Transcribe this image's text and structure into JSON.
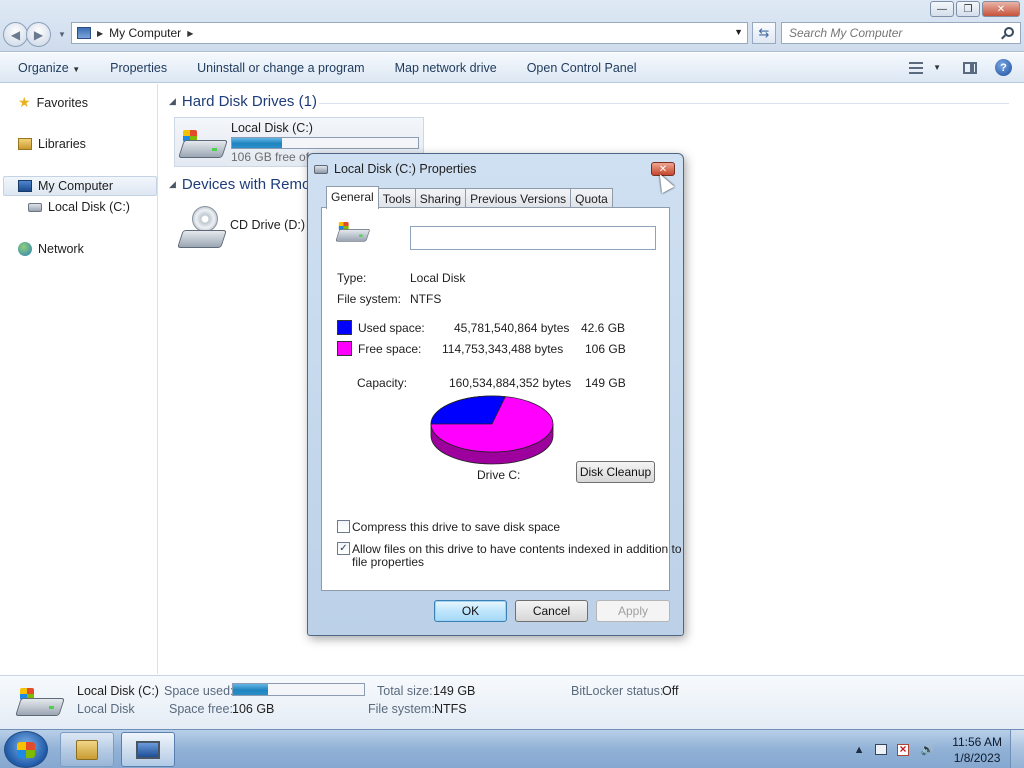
{
  "window": {
    "controls": {
      "minimize": "—",
      "maximize": "❐",
      "close": "✕"
    }
  },
  "address": {
    "crumbs": [
      "My Computer"
    ]
  },
  "search": {
    "placeholder": "Search My Computer"
  },
  "toolbar": {
    "items": [
      "Organize",
      "Properties",
      "Uninstall or change a program",
      "Map network drive",
      "Open Control Panel"
    ],
    "organize_arrow": "▼"
  },
  "nav": {
    "favorites": "Favorites",
    "libraries": "Libraries",
    "computer": "My Computer",
    "local_disk": "Local Disk (C:)",
    "network": "Network"
  },
  "content": {
    "hdd_group": "Hard Disk Drives (1)",
    "hdd": {
      "name": "Local Disk (C:)",
      "free_text": "106 GB free of",
      "used_fraction": 0.27
    },
    "removable_group": "Devices with Remo",
    "cd": {
      "name": "CD Drive (D:)"
    }
  },
  "details": {
    "name": "Local Disk (C:)",
    "type": "Local Disk",
    "space_used_label": "Space used:",
    "space_used_fraction": 0.27,
    "space_free_label": "Space free:",
    "space_free": "106 GB",
    "total_size_label": "Total size:",
    "total_size": "149 GB",
    "filesystem_label": "File system:",
    "filesystem": "NTFS",
    "bitlocker_label": "BitLocker status:",
    "bitlocker": "Off"
  },
  "dialog": {
    "title": "Local Disk (C:) Properties",
    "close": "✕",
    "tabs": [
      "General",
      "Tools",
      "Sharing",
      "Previous Versions",
      "Quota"
    ],
    "name_value": "",
    "type_label": "Type:",
    "type_value": "Local Disk",
    "fs_label": "File system:",
    "fs_value": "NTFS",
    "used_label": "Used space:",
    "used_bytes": "45,781,540,864 bytes",
    "used_gb": "42.6 GB",
    "free_label": "Free space:",
    "free_bytes": "114,753,343,488 bytes",
    "free_gb": "106 GB",
    "capacity_label": "Capacity:",
    "capacity_bytes": "160,534,884,352 bytes",
    "capacity_gb": "149 GB",
    "drive_label": "Drive C:",
    "cleanup_button": "Disk Cleanup",
    "compress_label": "Compress this drive to save disk space",
    "compress_checked": false,
    "index_label_1": "Allow files on this drive to have contents indexed in addition to",
    "index_label_2": "file properties",
    "index_checked": true,
    "check_mark": "✓",
    "ok": "OK",
    "cancel": "Cancel",
    "apply": "Apply",
    "used_color": "#0000ff",
    "free_color": "#ff00ff",
    "used_fraction": 0.285
  },
  "taskbar": {
    "time": "11:56 AM",
    "date": "1/8/2023",
    "tray_arrow": "▲",
    "volume": "🔊"
  }
}
